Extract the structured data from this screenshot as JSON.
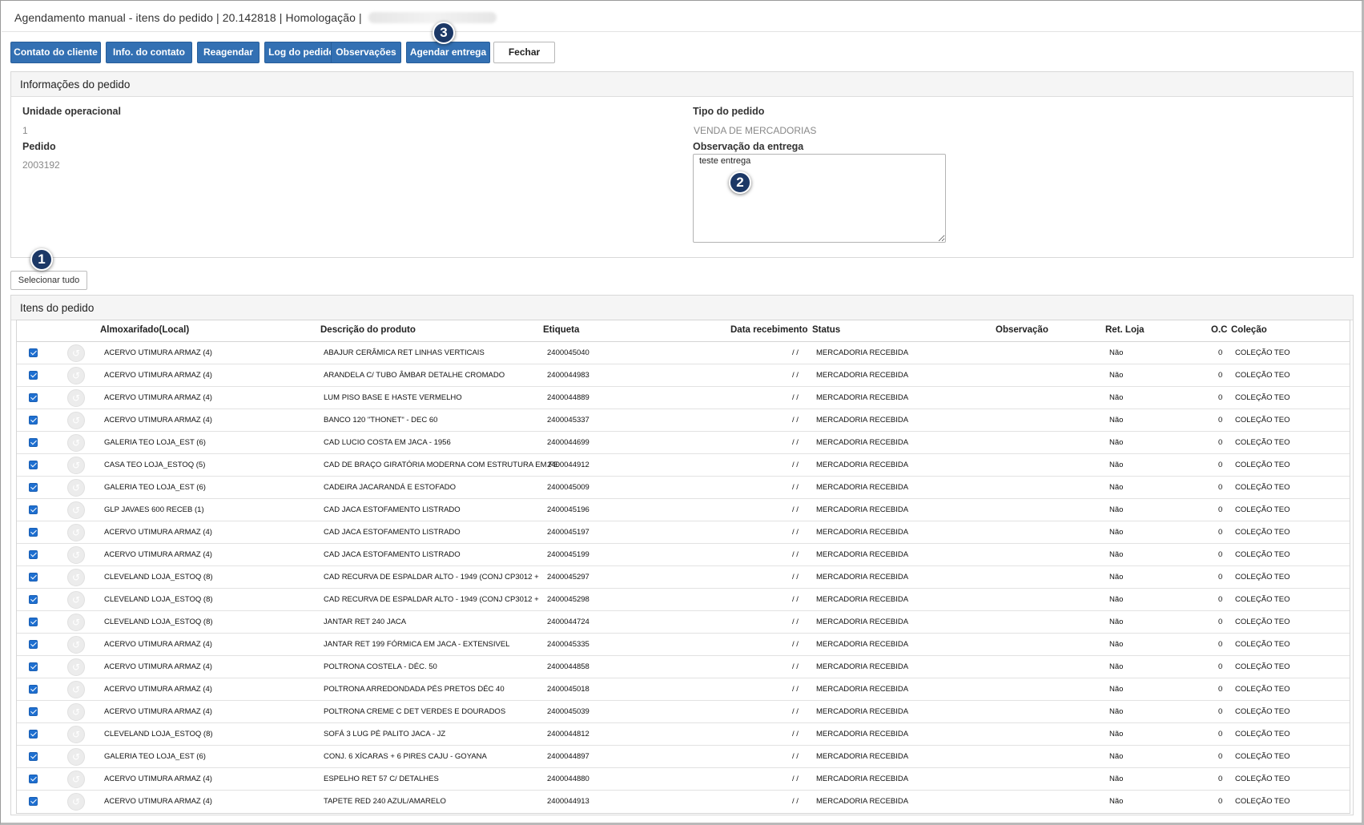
{
  "window": {
    "title": "Agendamento manual - itens do pedido | 20.142818 | Homologação |"
  },
  "toolbar": {
    "buttons": [
      {
        "label": "Contato do cliente"
      },
      {
        "label": "Info. do contato"
      },
      {
        "label": "Reagendar"
      },
      {
        "label": "Log do pedido"
      },
      {
        "label": "Observações"
      },
      {
        "label": "Agendar entrega"
      },
      {
        "label": "Fechar"
      }
    ]
  },
  "markers": {
    "m1": "1",
    "m2": "2",
    "m3": "3"
  },
  "info": {
    "title": "Informações do pedido",
    "unidade_label": "Unidade operacional",
    "unidade_value": "1",
    "pedido_label": "Pedido",
    "pedido_value": "2003192",
    "tipo_label": "Tipo do pedido",
    "tipo_value": "VENDA DE MERCADORIAS",
    "obs_label": "Observação da entrega",
    "obs_value": "teste entrega"
  },
  "select_all_label": "Selecionar tudo",
  "items": {
    "title": "Itens do pedido",
    "columns": {
      "almox": "Almoxarifado(Local)",
      "desc": "Descrição do produto",
      "etiqueta": "Etiqueta",
      "data": "Data recebimento",
      "status": "Status",
      "obs": "Observação",
      "ret": "Ret. Loja",
      "oc": "O.C",
      "colecao": "Coleção"
    },
    "rows": [
      {
        "checked": true,
        "almox": "ACERVO UTIMURA ARMAZ (4)",
        "desc": "ABAJUR CERÂMICA RET LINHAS VERTICAIS",
        "etiqueta": "2400045040",
        "data": "/ /",
        "status": "MERCADORIA RECEBIDA",
        "obs": "",
        "ret": "Não",
        "oc": "0",
        "colecao": "COLEÇÃO TEO"
      },
      {
        "checked": true,
        "almox": "ACERVO UTIMURA ARMAZ (4)",
        "desc": "ARANDELA C/ TUBO ÂMBAR DETALHE CROMADO",
        "etiqueta": "2400044983",
        "data": "/ /",
        "status": "MERCADORIA RECEBIDA",
        "obs": "",
        "ret": "Não",
        "oc": "0",
        "colecao": "COLEÇÃO TEO"
      },
      {
        "checked": true,
        "almox": "ACERVO UTIMURA ARMAZ (4)",
        "desc": "LUM PISO BASE E HASTE VERMELHO",
        "etiqueta": "2400044889",
        "data": "/ /",
        "status": "MERCADORIA RECEBIDA",
        "obs": "",
        "ret": "Não",
        "oc": "0",
        "colecao": "COLEÇÃO TEO"
      },
      {
        "checked": true,
        "almox": "ACERVO UTIMURA ARMAZ (4)",
        "desc": "BANCO 120 \"THONET\" - DEC 60",
        "etiqueta": "2400045337",
        "data": "/ /",
        "status": "MERCADORIA RECEBIDA",
        "obs": "",
        "ret": "Não",
        "oc": "0",
        "colecao": "COLEÇÃO TEO"
      },
      {
        "checked": true,
        "almox": "GALERIA TEO LOJA_EST (6)",
        "desc": "CAD LUCIO COSTA EM JACA - 1956",
        "etiqueta": "2400044699",
        "data": "/ /",
        "status": "MERCADORIA RECEBIDA",
        "obs": "",
        "ret": "Não",
        "oc": "0",
        "colecao": "COLEÇÃO TEO"
      },
      {
        "checked": true,
        "almox": "CASA TEO LOJA_ESTOQ (5)",
        "desc": "CAD DE BRAÇO GIRATÓRIA MODERNA COM ESTRUTURA EM FE",
        "etiqueta": "2400044912",
        "data": "/ /",
        "status": "MERCADORIA RECEBIDA",
        "obs": "",
        "ret": "Não",
        "oc": "0",
        "colecao": "COLEÇÃO TEO"
      },
      {
        "checked": true,
        "almox": "GALERIA TEO LOJA_EST (6)",
        "desc": "CADEIRA JACARANDÁ E ESTOFADO",
        "etiqueta": "2400045009",
        "data": "/ /",
        "status": "MERCADORIA RECEBIDA",
        "obs": "",
        "ret": "Não",
        "oc": "0",
        "colecao": "COLEÇÃO TEO"
      },
      {
        "checked": true,
        "almox": "GLP JAVAES 600 RECEB (1)",
        "desc": "CAD JACA ESTOFAMENTO LISTRADO",
        "etiqueta": "2400045196",
        "data": "/ /",
        "status": "MERCADORIA RECEBIDA",
        "obs": "",
        "ret": "Não",
        "oc": "0",
        "colecao": "COLEÇÃO TEO"
      },
      {
        "checked": true,
        "almox": "ACERVO UTIMURA ARMAZ (4)",
        "desc": "CAD JACA ESTOFAMENTO LISTRADO",
        "etiqueta": "2400045197",
        "data": "/ /",
        "status": "MERCADORIA RECEBIDA",
        "obs": "",
        "ret": "Não",
        "oc": "0",
        "colecao": "COLEÇÃO TEO"
      },
      {
        "checked": true,
        "almox": "ACERVO UTIMURA ARMAZ (4)",
        "desc": "CAD JACA ESTOFAMENTO LISTRADO",
        "etiqueta": "2400045199",
        "data": "/ /",
        "status": "MERCADORIA RECEBIDA",
        "obs": "",
        "ret": "Não",
        "oc": "0",
        "colecao": "COLEÇÃO TEO"
      },
      {
        "checked": true,
        "almox": "CLEVELAND LOJA_ESTOQ (8)",
        "desc": "CAD RECURVA DE ESPALDAR ALTO - 1949 (CONJ CP3012 +",
        "etiqueta": "2400045297",
        "data": "/ /",
        "status": "MERCADORIA RECEBIDA",
        "obs": "",
        "ret": "Não",
        "oc": "0",
        "colecao": "COLEÇÃO TEO"
      },
      {
        "checked": true,
        "almox": "CLEVELAND LOJA_ESTOQ (8)",
        "desc": "CAD RECURVA DE ESPALDAR ALTO - 1949 (CONJ CP3012 +",
        "etiqueta": "2400045298",
        "data": "/ /",
        "status": "MERCADORIA RECEBIDA",
        "obs": "",
        "ret": "Não",
        "oc": "0",
        "colecao": "COLEÇÃO TEO"
      },
      {
        "checked": true,
        "almox": "CLEVELAND LOJA_ESTOQ (8)",
        "desc": "JANTAR RET 240 JACA",
        "etiqueta": "2400044724",
        "data": "/ /",
        "status": "MERCADORIA RECEBIDA",
        "obs": "",
        "ret": "Não",
        "oc": "0",
        "colecao": "COLEÇÃO TEO"
      },
      {
        "checked": true,
        "almox": "ACERVO UTIMURA ARMAZ (4)",
        "desc": "JANTAR RET 199 FÓRMICA EM JACA - EXTENSIVEL",
        "etiqueta": "2400045335",
        "data": "/ /",
        "status": "MERCADORIA RECEBIDA",
        "obs": "",
        "ret": "Não",
        "oc": "0",
        "colecao": "COLEÇÃO TEO"
      },
      {
        "checked": true,
        "almox": "ACERVO UTIMURA ARMAZ (4)",
        "desc": "POLTRONA COSTELA - DÉC. 50",
        "etiqueta": "2400044858",
        "data": "/ /",
        "status": "MERCADORIA RECEBIDA",
        "obs": "",
        "ret": "Não",
        "oc": "0",
        "colecao": "COLEÇÃO TEO"
      },
      {
        "checked": true,
        "almox": "ACERVO UTIMURA ARMAZ (4)",
        "desc": "POLTRONA ARREDONDADA PÉS PRETOS DÉC 40",
        "etiqueta": "2400045018",
        "data": "/ /",
        "status": "MERCADORIA RECEBIDA",
        "obs": "",
        "ret": "Não",
        "oc": "0",
        "colecao": "COLEÇÃO TEO"
      },
      {
        "checked": true,
        "almox": "ACERVO UTIMURA ARMAZ (4)",
        "desc": "POLTRONA CREME C DET VERDES E DOURADOS",
        "etiqueta": "2400045039",
        "data": "/ /",
        "status": "MERCADORIA RECEBIDA",
        "obs": "",
        "ret": "Não",
        "oc": "0",
        "colecao": "COLEÇÃO TEO"
      },
      {
        "checked": true,
        "almox": "CLEVELAND LOJA_ESTOQ (8)",
        "desc": "SOFÁ 3 LUG PÉ PALITO JACA - JZ",
        "etiqueta": "2400044812",
        "data": "/ /",
        "status": "MERCADORIA RECEBIDA",
        "obs": "",
        "ret": "Não",
        "oc": "0",
        "colecao": "COLEÇÃO TEO"
      },
      {
        "checked": true,
        "almox": "GALERIA TEO LOJA_EST (6)",
        "desc": "CONJ. 6 XÍCARAS + 6 PIRES CAJU - GOYANA",
        "etiqueta": "2400044897",
        "data": "/ /",
        "status": "MERCADORIA RECEBIDA",
        "obs": "",
        "ret": "Não",
        "oc": "0",
        "colecao": "COLEÇÃO TEO"
      },
      {
        "checked": true,
        "almox": "ACERVO UTIMURA ARMAZ (4)",
        "desc": "ESPELHO RET 57 C/ DETALHES",
        "etiqueta": "2400044880",
        "data": "/ /",
        "status": "MERCADORIA RECEBIDA",
        "obs": "",
        "ret": "Não",
        "oc": "0",
        "colecao": "COLEÇÃO TEO"
      },
      {
        "checked": true,
        "almox": "ACERVO UTIMURA ARMAZ (4)",
        "desc": "TAPETE RED 240 AZUL/AMARELO",
        "etiqueta": "2400044913",
        "data": "/ /",
        "status": "MERCADORIA RECEBIDA",
        "obs": "",
        "ret": "Não",
        "oc": "0",
        "colecao": "COLEÇÃO TEO"
      }
    ]
  },
  "colors": {
    "primary_button": "#3370b3",
    "marker": "#1c3866",
    "checkbox": "#1e6fd0"
  }
}
